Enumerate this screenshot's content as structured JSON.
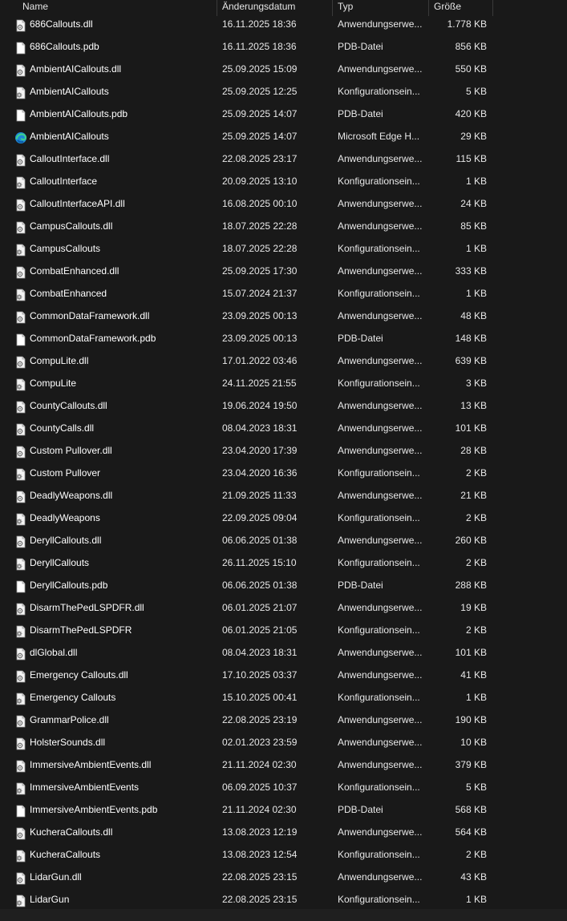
{
  "columns": {
    "name": "Name",
    "date": "Änderungsdatum",
    "type": "Typ",
    "size": "Größe"
  },
  "files": [
    {
      "icon": "dll-icon",
      "name": "686Callouts.dll",
      "date": "16.11.2025 18:36",
      "type": "Anwendungserwe...",
      "size": "1.778 KB"
    },
    {
      "icon": "pdb-icon",
      "name": "686Callouts.pdb",
      "date": "16.11.2025 18:36",
      "type": "PDB-Datei",
      "size": "856 KB"
    },
    {
      "icon": "dll-icon",
      "name": "AmbientAICallouts.dll",
      "date": "25.09.2025 15:09",
      "type": "Anwendungserwe...",
      "size": "550 KB"
    },
    {
      "icon": "config-icon",
      "name": "AmbientAICallouts",
      "date": "25.09.2025 12:25",
      "type": "Konfigurationsein...",
      "size": "5 KB"
    },
    {
      "icon": "pdb-icon",
      "name": "AmbientAICallouts.pdb",
      "date": "25.09.2025 14:07",
      "type": "PDB-Datei",
      "size": "420 KB"
    },
    {
      "icon": "edge-icon",
      "name": "AmbientAICallouts",
      "date": "25.09.2025 14:07",
      "type": "Microsoft Edge H...",
      "size": "29 KB"
    },
    {
      "icon": "dll-icon",
      "name": "CalloutInterface.dll",
      "date": "22.08.2025 23:17",
      "type": "Anwendungserwe...",
      "size": "115 KB"
    },
    {
      "icon": "config-icon",
      "name": "CalloutInterface",
      "date": "20.09.2025 13:10",
      "type": "Konfigurationsein...",
      "size": "1 KB"
    },
    {
      "icon": "dll-icon",
      "name": "CalloutInterfaceAPI.dll",
      "date": "16.08.2025 00:10",
      "type": "Anwendungserwe...",
      "size": "24 KB"
    },
    {
      "icon": "dll-icon",
      "name": "CampusCallouts.dll",
      "date": "18.07.2025 22:28",
      "type": "Anwendungserwe...",
      "size": "85 KB"
    },
    {
      "icon": "config-icon",
      "name": "CampusCallouts",
      "date": "18.07.2025 22:28",
      "type": "Konfigurationsein...",
      "size": "1 KB"
    },
    {
      "icon": "dll-icon",
      "name": "CombatEnhanced.dll",
      "date": "25.09.2025 17:30",
      "type": "Anwendungserwe...",
      "size": "333 KB"
    },
    {
      "icon": "config-icon",
      "name": "CombatEnhanced",
      "date": "15.07.2024 21:37",
      "type": "Konfigurationsein...",
      "size": "1 KB"
    },
    {
      "icon": "dll-icon",
      "name": "CommonDataFramework.dll",
      "date": "23.09.2025 00:13",
      "type": "Anwendungserwe...",
      "size": "48 KB"
    },
    {
      "icon": "pdb-icon",
      "name": "CommonDataFramework.pdb",
      "date": "23.09.2025 00:13",
      "type": "PDB-Datei",
      "size": "148 KB"
    },
    {
      "icon": "dll-icon",
      "name": "CompuLite.dll",
      "date": "17.01.2022 03:46",
      "type": "Anwendungserwe...",
      "size": "639 KB"
    },
    {
      "icon": "config-icon",
      "name": "CompuLite",
      "date": "24.11.2025 21:55",
      "type": "Konfigurationsein...",
      "size": "3 KB"
    },
    {
      "icon": "dll-icon",
      "name": "CountyCallouts.dll",
      "date": "19.06.2024 19:50",
      "type": "Anwendungserwe...",
      "size": "13 KB"
    },
    {
      "icon": "dll-icon",
      "name": "CountyCalls.dll",
      "date": "08.04.2023 18:31",
      "type": "Anwendungserwe...",
      "size": "101 KB"
    },
    {
      "icon": "dll-icon",
      "name": "Custom Pullover.dll",
      "date": "23.04.2020 17:39",
      "type": "Anwendungserwe...",
      "size": "28 KB"
    },
    {
      "icon": "config-icon",
      "name": "Custom Pullover",
      "date": "23.04.2020 16:36",
      "type": "Konfigurationsein...",
      "size": "2 KB"
    },
    {
      "icon": "dll-icon",
      "name": "DeadlyWeapons.dll",
      "date": "21.09.2025 11:33",
      "type": "Anwendungserwe...",
      "size": "21 KB"
    },
    {
      "icon": "config-icon",
      "name": "DeadlyWeapons",
      "date": "22.09.2025 09:04",
      "type": "Konfigurationsein...",
      "size": "2 KB"
    },
    {
      "icon": "dll-icon",
      "name": "DeryllCallouts.dll",
      "date": "06.06.2025 01:38",
      "type": "Anwendungserwe...",
      "size": "260 KB"
    },
    {
      "icon": "config-icon",
      "name": "DeryllCallouts",
      "date": "26.11.2025 15:10",
      "type": "Konfigurationsein...",
      "size": "2 KB"
    },
    {
      "icon": "pdb-icon",
      "name": "DeryllCallouts.pdb",
      "date": "06.06.2025 01:38",
      "type": "PDB-Datei",
      "size": "288 KB"
    },
    {
      "icon": "dll-icon",
      "name": "DisarmThePedLSPDFR.dll",
      "date": "06.01.2025 21:07",
      "type": "Anwendungserwe...",
      "size": "19 KB"
    },
    {
      "icon": "config-icon",
      "name": "DisarmThePedLSPDFR",
      "date": "06.01.2025 21:05",
      "type": "Konfigurationsein...",
      "size": "2 KB"
    },
    {
      "icon": "dll-icon",
      "name": "dlGlobal.dll",
      "date": "08.04.2023 18:31",
      "type": "Anwendungserwe...",
      "size": "101 KB"
    },
    {
      "icon": "dll-icon",
      "name": "Emergency Callouts.dll",
      "date": "17.10.2025 03:37",
      "type": "Anwendungserwe...",
      "size": "41 KB"
    },
    {
      "icon": "config-icon",
      "name": "Emergency Callouts",
      "date": "15.10.2025 00:41",
      "type": "Konfigurationsein...",
      "size": "1 KB"
    },
    {
      "icon": "dll-icon",
      "name": "GrammarPolice.dll",
      "date": "22.08.2025 23:19",
      "type": "Anwendungserwe...",
      "size": "190 KB"
    },
    {
      "icon": "dll-icon",
      "name": "HolsterSounds.dll",
      "date": "02.01.2023 23:59",
      "type": "Anwendungserwe...",
      "size": "10 KB"
    },
    {
      "icon": "dll-icon",
      "name": "ImmersiveAmbientEvents.dll",
      "date": "21.11.2024 02:30",
      "type": "Anwendungserwe...",
      "size": "379 KB"
    },
    {
      "icon": "config-icon",
      "name": "ImmersiveAmbientEvents",
      "date": "06.09.2025 10:37",
      "type": "Konfigurationsein...",
      "size": "5 KB"
    },
    {
      "icon": "pdb-icon",
      "name": "ImmersiveAmbientEvents.pdb",
      "date": "21.11.2024 02:30",
      "type": "PDB-Datei",
      "size": "568 KB"
    },
    {
      "icon": "dll-icon",
      "name": "KucheraCallouts.dll",
      "date": "13.08.2023 12:19",
      "type": "Anwendungserwe...",
      "size": "564 KB"
    },
    {
      "icon": "config-icon",
      "name": "KucheraCallouts",
      "date": "13.08.2023 12:54",
      "type": "Konfigurationsein...",
      "size": "2 KB"
    },
    {
      "icon": "dll-icon",
      "name": "LidarGun.dll",
      "date": "22.08.2025 23:15",
      "type": "Anwendungserwe...",
      "size": "43 KB"
    },
    {
      "icon": "config-icon",
      "name": "LidarGun",
      "date": "22.08.2025 23:15",
      "type": "Konfigurationsein...",
      "size": "1 KB"
    }
  ]
}
